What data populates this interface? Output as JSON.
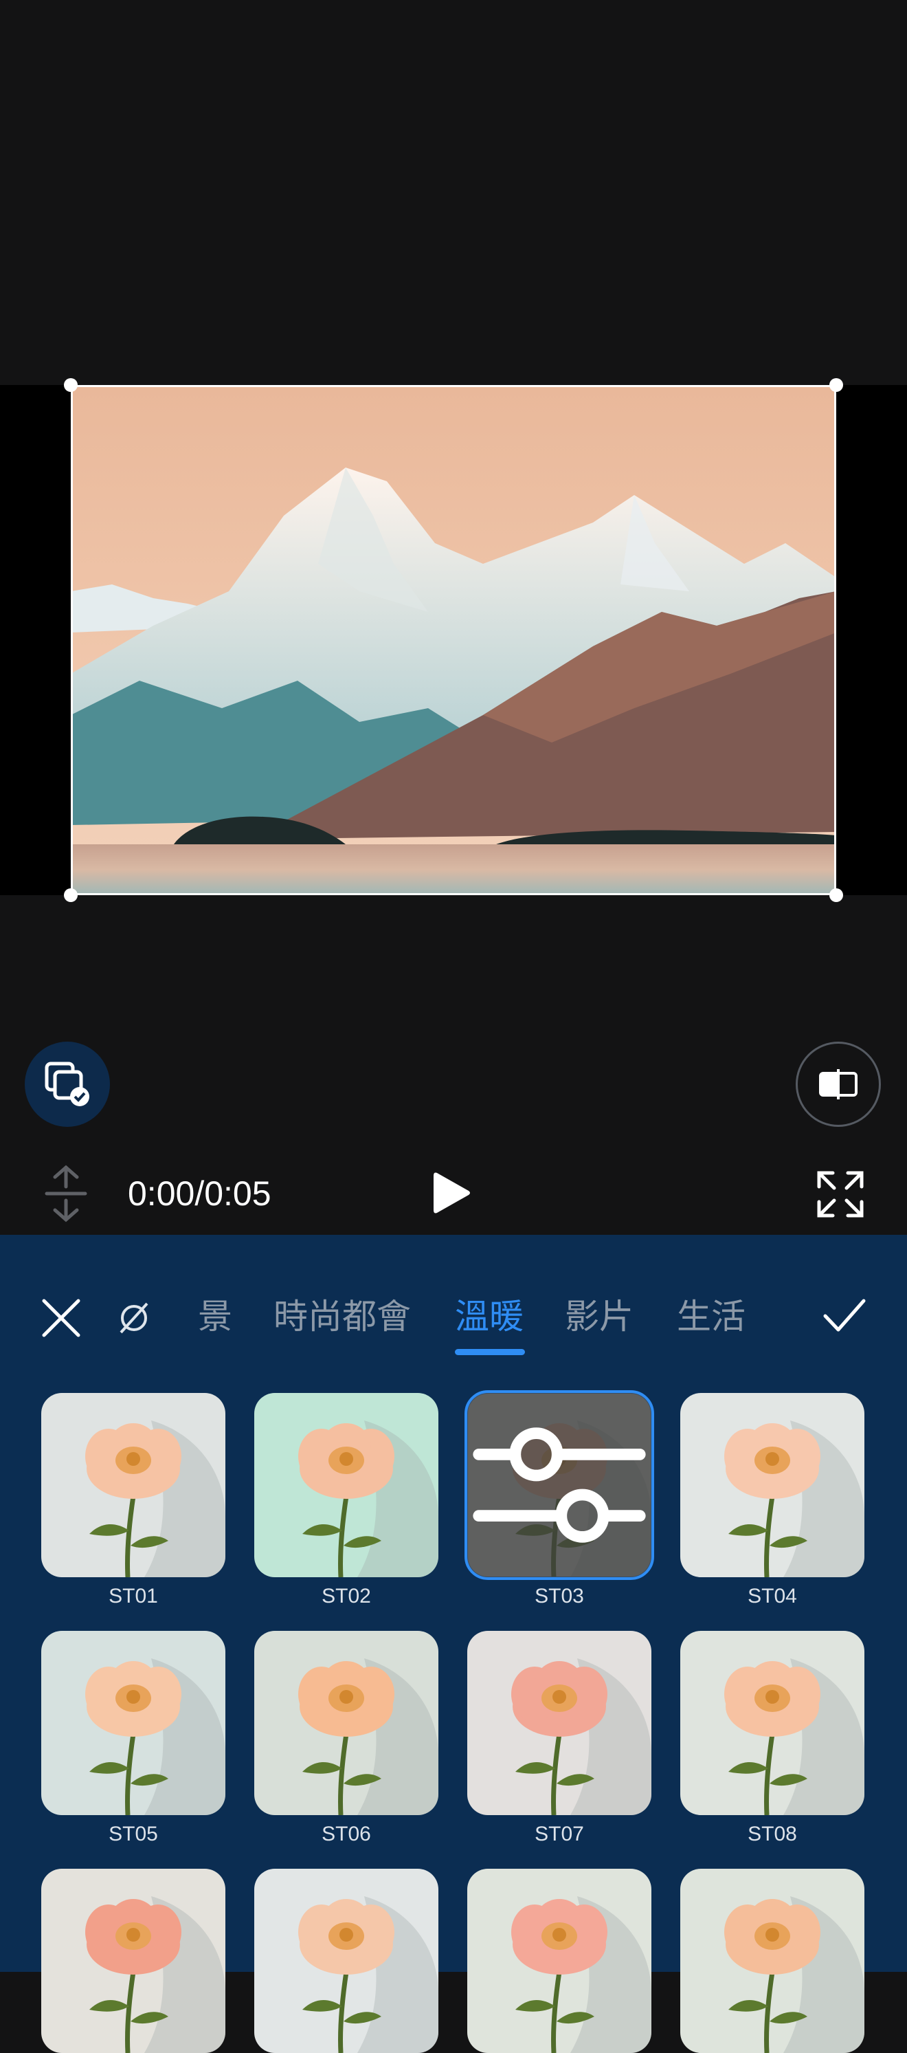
{
  "player": {
    "timecode": "0:00/0:05"
  },
  "icons": {
    "layer": "layers-check-icon",
    "compare": "split-compare-icon",
    "vertical_resize": "vertical-resize-icon",
    "play": "play-icon",
    "fullscreen": "fullscreen-icon",
    "close": "close-icon",
    "no_filter": "no-filter-icon",
    "confirm": "checkmark-icon",
    "adjust": "sliders-icon"
  },
  "filter_panel": {
    "tabs": [
      {
        "label": "景",
        "active": false
      },
      {
        "label": "時尚都會",
        "active": false
      },
      {
        "label": "溫暖",
        "active": true
      },
      {
        "label": "影片",
        "active": false
      },
      {
        "label": "生活",
        "active": false
      }
    ],
    "filters": [
      {
        "label": "ST01",
        "selected": false
      },
      {
        "label": "ST02",
        "selected": false
      },
      {
        "label": "ST03",
        "selected": true
      },
      {
        "label": "ST04",
        "selected": false
      },
      {
        "label": "ST05",
        "selected": false
      },
      {
        "label": "ST06",
        "selected": false
      },
      {
        "label": "ST07",
        "selected": false
      },
      {
        "label": "ST08",
        "selected": false
      },
      {
        "label": "",
        "selected": false
      },
      {
        "label": "",
        "selected": false
      },
      {
        "label": "",
        "selected": false
      },
      {
        "label": "",
        "selected": false
      }
    ]
  },
  "colors": {
    "background": "#131314",
    "panel": "#0b2d52",
    "accent": "#2f8df4",
    "tab_inactive": "#8c99a8"
  }
}
